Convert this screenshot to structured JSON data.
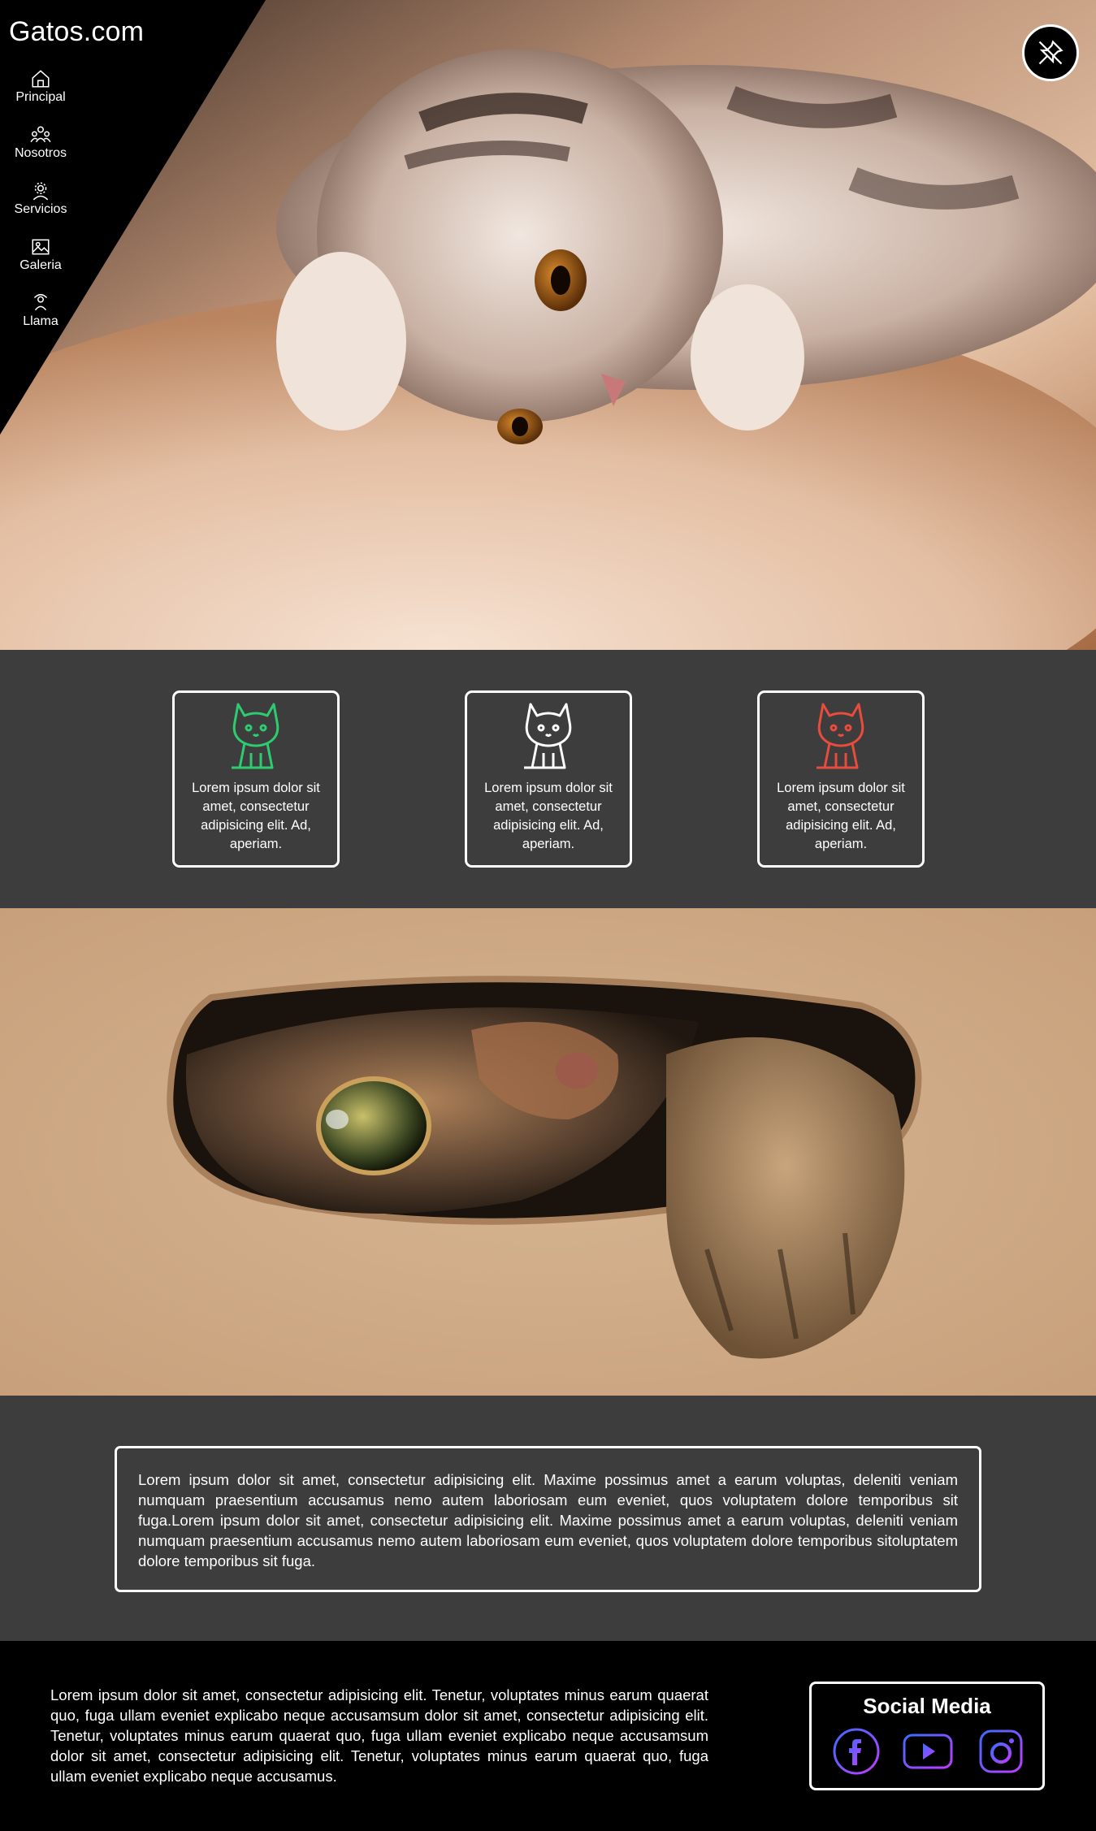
{
  "brand": {
    "name": "Gatos.com"
  },
  "nav": {
    "items": [
      {
        "label": "Principal",
        "icon": "home-icon"
      },
      {
        "label": "Nosotros",
        "icon": "team-icon"
      },
      {
        "label": "Servicios",
        "icon": "settings-icon"
      },
      {
        "label": "Galeria",
        "icon": "gallery-icon"
      },
      {
        "label": "Llama",
        "icon": "call-icon"
      }
    ]
  },
  "pin_button": {
    "icon": "pin-icon"
  },
  "features": {
    "cards": [
      {
        "text": "Lorem ipsum dolor sit amet, consectetur adipisicing elit. Ad, aperiam.",
        "icon": "cat-icon",
        "color": "#2ecc71"
      },
      {
        "text": "Lorem ipsum dolor sit amet, consectetur adipisicing elit. Ad, aperiam.",
        "icon": "cat-icon",
        "color": "#ffffff"
      },
      {
        "text": "Lorem ipsum dolor sit amet, consectetur adipisicing elit. Ad, aperiam.",
        "icon": "cat-icon",
        "color": "#e74c3c"
      }
    ]
  },
  "textband": {
    "body": "Lorem ipsum dolor sit amet, consectetur adipisicing elit. Maxime possimus amet a earum voluptas, deleniti veniam numquam praesentium accusamus nemo autem laboriosam eum eveniet, quos voluptatem dolore temporibus sit fuga.Lorem ipsum dolor sit amet, consectetur adipisicing elit. Maxime possimus amet a earum voluptas, deleniti veniam numquam praesentium accusamus nemo autem laboriosam eum eveniet, quos voluptatem dolore temporibus sitoluptatem dolore temporibus sit fuga."
  },
  "footer": {
    "body": "Lorem ipsum dolor sit amet, consectetur adipisicing elit. Tenetur, voluptates minus earum quaerat quo, fuga ullam eveniet explicabo neque accusamsum dolor sit amet, consectetur adipisicing elit. Tenetur, voluptates minus earum quaerat quo, fuga ullam eveniet explicabo neque accusamsum dolor sit amet, consectetur adipisicing elit. Tenetur, voluptates minus earum quaerat quo, fuga ullam eveniet explicabo neque accusamus.",
    "social": {
      "title": "Social Media",
      "links": [
        {
          "icon": "facebook-icon"
        },
        {
          "icon": "youtube-icon"
        },
        {
          "icon": "instagram-icon"
        }
      ],
      "gradient": [
        "#3b6cff",
        "#c13cff"
      ]
    }
  },
  "colors": {
    "band": "#3d3d3d",
    "footer": "#000000",
    "text": "#ffffff"
  }
}
